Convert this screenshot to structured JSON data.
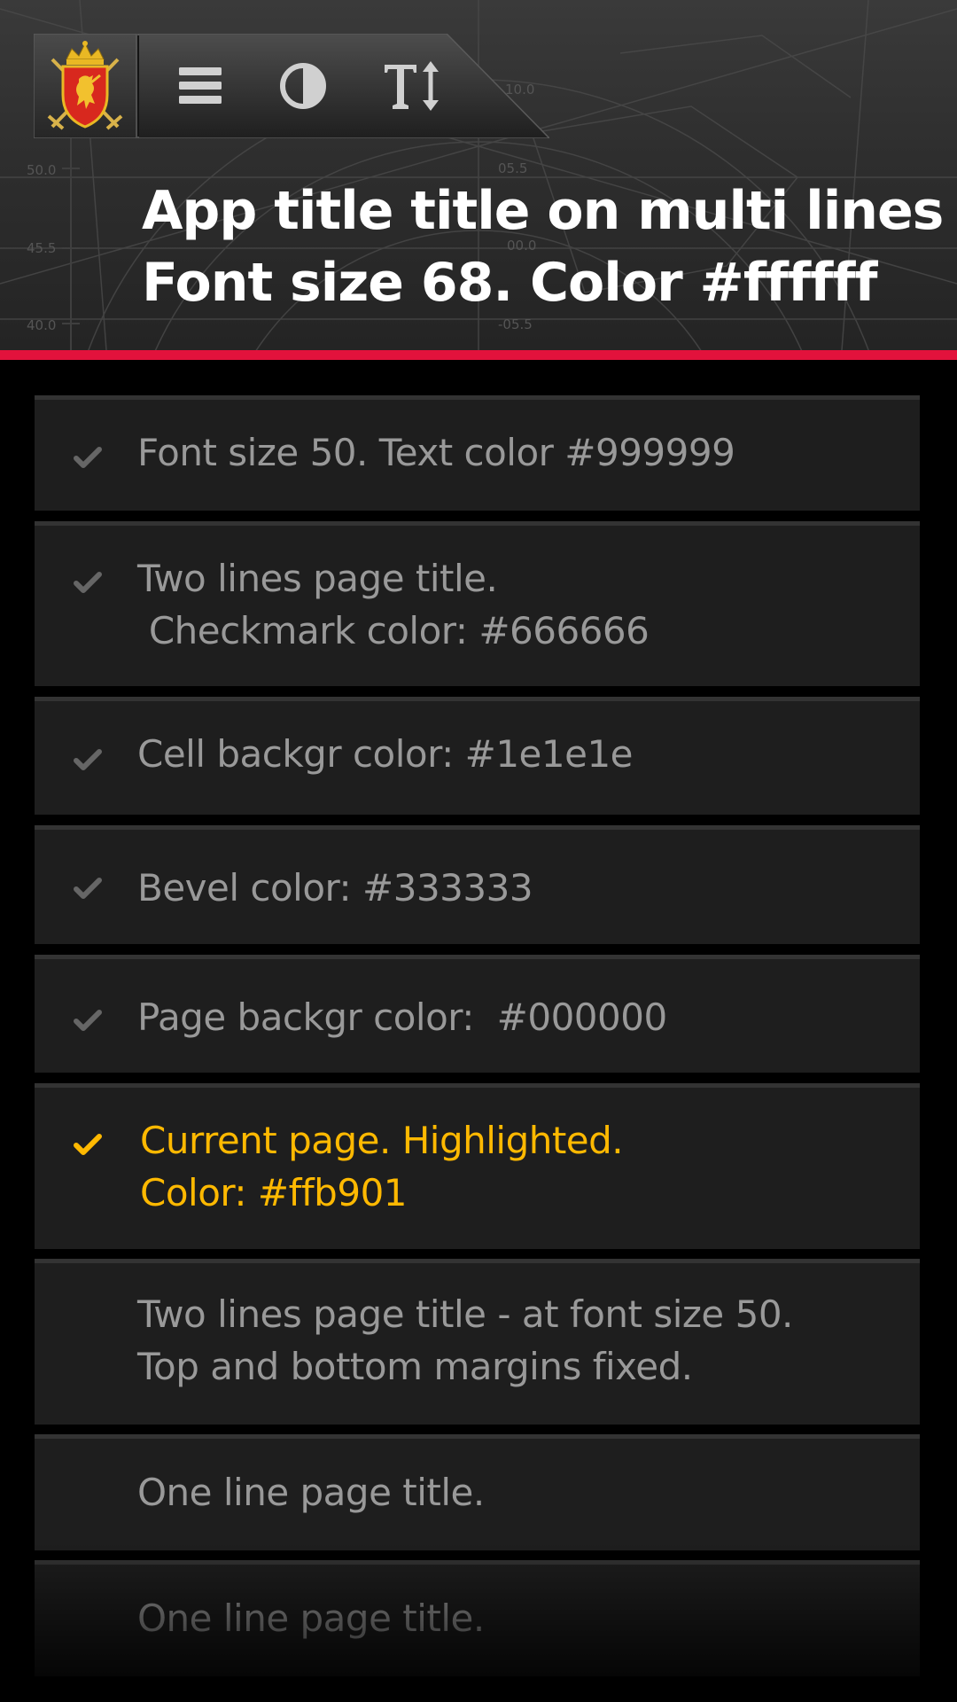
{
  "header": {
    "title_line1": "App title title on multi lines",
    "title_line2": "Font size 68. Color #ffffff",
    "accent_color": "#e2123c",
    "chart_labels": {
      "left_50": "50.0",
      "left_45": "45.5",
      "left_40": "40.0",
      "mid_05": "05.5",
      "mid_00": "00.0",
      "mid_neg05": "-05.5",
      "right_10": "10.0"
    }
  },
  "toolbar": {
    "emblem_icon": "coat-of-arms-icon",
    "menu_icon": "menu-icon",
    "contrast_icon": "contrast-icon",
    "textsize_icon": "text-size-icon"
  },
  "list": {
    "items": [
      {
        "label": "Font size 50. Text color #999999",
        "checked": true,
        "current": false
      },
      {
        "label": "Two lines page title.\n Checkmark color: #666666",
        "checked": true,
        "current": false
      },
      {
        "label": "Cell backgr color: #1e1e1e",
        "checked": true,
        "current": false
      },
      {
        "label": "Bevel color: #333333",
        "checked": true,
        "current": false
      },
      {
        "label": "Page backgr color:  #000000",
        "checked": true,
        "current": false
      },
      {
        "label": "Current page. Highlighted.\nColor: #ffb901",
        "checked": true,
        "current": true
      },
      {
        "label": "Two lines page title - at font size 50.\nTop and bottom margins fixed.",
        "checked": false,
        "current": false
      },
      {
        "label": "One line page title.",
        "checked": false,
        "current": false
      },
      {
        "label": "One line page title.",
        "checked": false,
        "current": false
      }
    ],
    "colors": {
      "text": "#999999",
      "checkmark": "#666666",
      "cell_background": "#1e1e1e",
      "bevel": "#333333",
      "page_background": "#000000",
      "highlight": "#ffb901"
    }
  }
}
